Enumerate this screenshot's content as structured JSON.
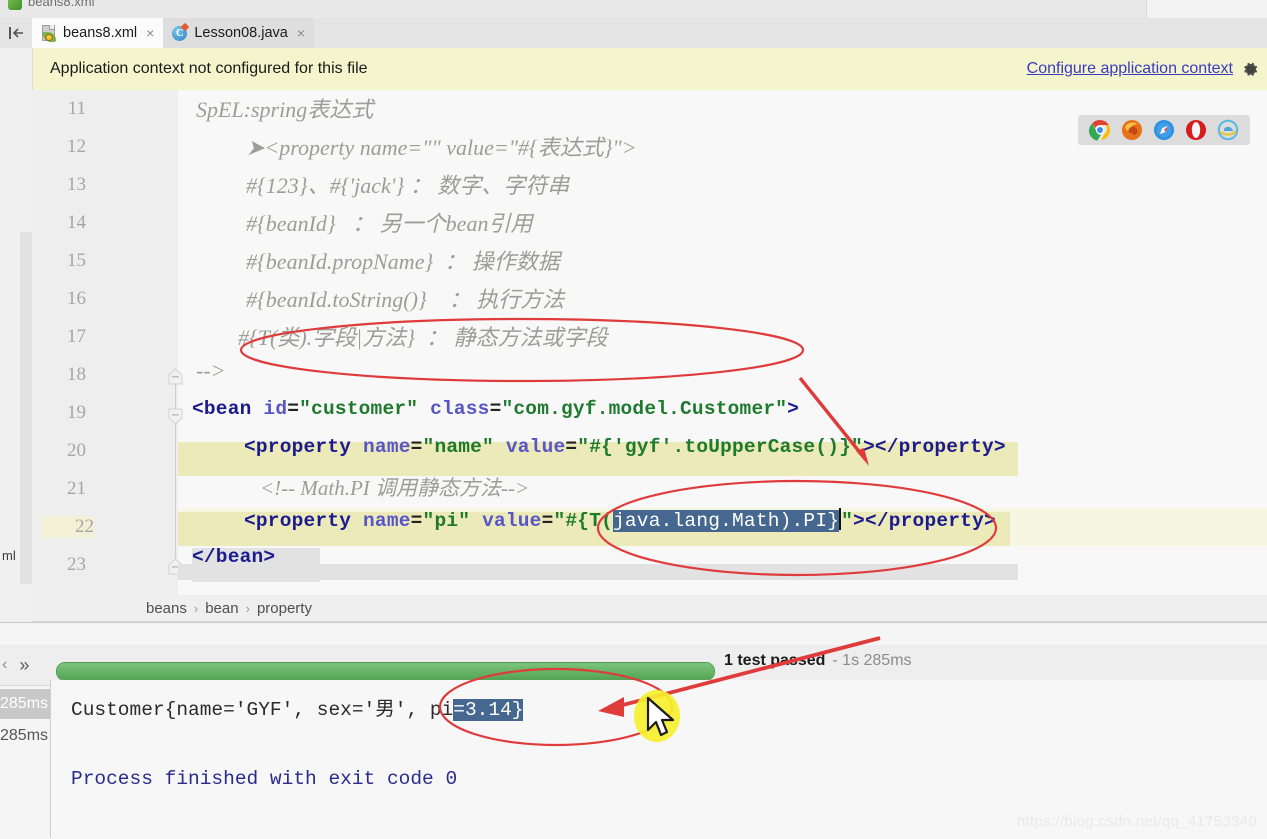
{
  "window": {
    "ghost_tab_label": "beans8.xml"
  },
  "tabs": [
    {
      "label": "beans8.xml",
      "icon": "xml-file-icon",
      "active": true,
      "close": "×"
    },
    {
      "label": "Lesson08.java",
      "icon": "java-class-icon",
      "active": false,
      "close": "×"
    }
  ],
  "banner": {
    "message": "Application context not configured for this file",
    "link": "Configure application context",
    "gear_icon": "gear-icon"
  },
  "browser_strip": {
    "icons": [
      "chrome-icon",
      "firefox-icon",
      "safari-icon",
      "opera-icon",
      "internet-explorer-icon"
    ],
    "colors": [
      "#2fa84f",
      "#e8701a",
      "#2d8fe0",
      "#d81a1a",
      "#57b9e0"
    ]
  },
  "left_rail": {
    "vertical_label": "ml"
  },
  "editor": {
    "first_line": 11,
    "current_line": 22,
    "line_numbers": [
      11,
      12,
      13,
      14,
      15,
      16,
      17,
      18,
      19,
      20,
      21,
      22,
      23
    ],
    "lines": [
      {
        "n": 11,
        "type": "comment",
        "text": "SpEL:spring表达式",
        "indent": 0
      },
      {
        "n": 12,
        "type": "comment",
        "text": "➤<property name=\"\" value=\"#{表达式}\">",
        "indent": 1
      },
      {
        "n": 13,
        "type": "comment",
        "text": "#{123}、#{'jack'} ： 数字、字符串",
        "indent": 1
      },
      {
        "n": 14,
        "type": "comment",
        "text": "#{beanId}   ： 另一个bean引用",
        "indent": 1
      },
      {
        "n": 15,
        "type": "comment",
        "text": "#{beanId.propName}  ： 操作数据",
        "indent": 1
      },
      {
        "n": 16,
        "type": "comment",
        "text": "#{beanId.toString()}    ： 执行方法",
        "indent": 1
      },
      {
        "n": 17,
        "type": "comment",
        "text": "#{T(类).字段|方法}  ： 静态方法或字段",
        "indent": 1
      },
      {
        "n": 18,
        "type": "comment",
        "text": "-->",
        "indent": 0
      },
      {
        "n": 21,
        "type": "comment",
        "text": "<!-- Math.PI 调用静态方法-->",
        "indent": 2
      }
    ],
    "line19": {
      "tag_open": "<bean",
      "attr1_name": "id",
      "attr1_value": "\"customer\"",
      "attr2_name": "class",
      "attr2_value": "\"com.gyf.model.Customer\"",
      "tag_close": ">"
    },
    "line20": {
      "tag_open": "<property",
      "attr1_name": "name",
      "attr1_value": "\"name\"",
      "attr2_name": "value",
      "attr2_value": "\"#{'gyf'.toUpperCase()}\"",
      "tag_close": ">",
      "closing_tag": "</property>"
    },
    "line22": {
      "tag_open": "<property",
      "attr1_name": "name",
      "attr1_value": "\"pi\"",
      "attr2_name": "value",
      "value_prefix": "\"#{T(",
      "value_selected": "java.lang.Math).PI}",
      "value_suffix": "\"",
      "tag_close": ">",
      "closing_tag": "</property>"
    },
    "line23": {
      "text": "</bean>"
    },
    "fold_lines": [
      18,
      19,
      23
    ]
  },
  "breadcrumb": {
    "items": [
      "beans",
      "bean",
      "property"
    ],
    "separator": "›"
  },
  "tool_window": {
    "nav_back_icon": "arrow-left-icon",
    "expand_icon": "double-chevron-right-icon",
    "progress_percent": 100,
    "status_text": "1 test passed",
    "duration": "- 1s 285ms",
    "tree_items": [
      "285ms",
      "285ms"
    ],
    "console_lines": [
      {
        "text_before": "Customer{name='GYF', sex='男', pi",
        "selected": "=3.14}",
        "color": "dark"
      },
      {
        "text": "Process finished with exit code 0",
        "color": "blue"
      }
    ]
  },
  "watermark": "https://blog.csdn.net/qq_41753340",
  "colors": {
    "banner_bg": "#f5f5cd",
    "link": "#3b3bbf",
    "selection": "#46678f",
    "current_line": "#f7f6e0",
    "annotation_red": "#e03b3b",
    "progress_green": "#52a352"
  }
}
